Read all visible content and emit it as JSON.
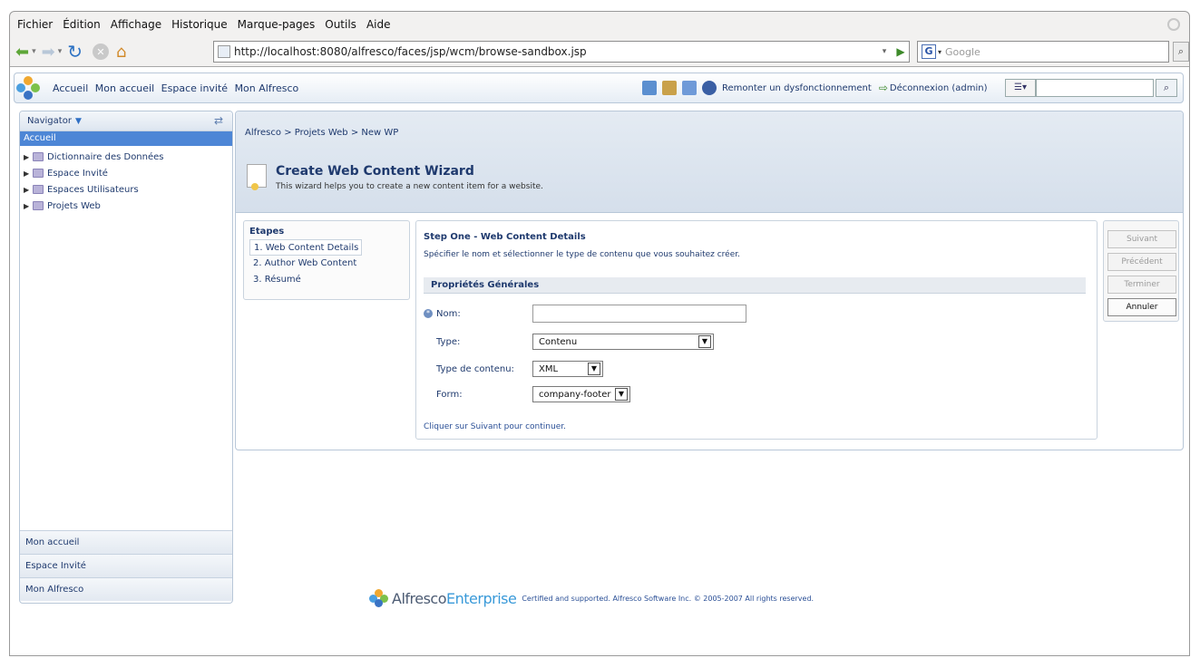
{
  "browser": {
    "menu": [
      {
        "label": "Fichier"
      },
      {
        "label": "Édition"
      },
      {
        "label": "Affichage"
      },
      {
        "label": "Historique"
      },
      {
        "label": "Marque-pages"
      },
      {
        "label": "Outils"
      },
      {
        "label": "Aide"
      }
    ],
    "url": "http://localhost:8080/alfresco/faces/jsp/wcm/browse-sandbox.jsp",
    "search_placeholder": "Google"
  },
  "topbar": {
    "links": [
      "Accueil",
      "Mon accueil",
      "Espace invité",
      "Mon Alfresco"
    ],
    "report_link": "Remonter un dysfonctionnement",
    "logout_link": "Déconnexion (admin)"
  },
  "navigator": {
    "title": "Navigator",
    "selected": "Accueil",
    "tree": [
      {
        "label": "Dictionnaire des Données"
      },
      {
        "label": "Espace Invité"
      },
      {
        "label": "Espaces Utilisateurs"
      },
      {
        "label": "Projets Web"
      }
    ],
    "bottom": [
      "Mon accueil",
      "Espace Invité",
      "Mon Alfresco"
    ]
  },
  "main": {
    "breadcrumb": "Alfresco > Projets Web > New WP",
    "title": "Create Web Content Wizard",
    "description": "This wizard helps you to create a new content item for a website.",
    "steps": {
      "title": "Etapes",
      "items": [
        "1. Web Content Details",
        "2. Author Web Content",
        "3. Résumé"
      ]
    },
    "content": {
      "title": "Step One - Web Content Details",
      "description": "Spécifier le nom et sélectionner le type de contenu que vous souhaitez créer.",
      "section": "Propriétés Générales",
      "fields": {
        "name_label": "Nom:",
        "name_value": "",
        "type_label": "Type:",
        "type_value": "Contenu",
        "content_type_label": "Type de contenu:",
        "content_type_value": "XML",
        "form_label": "Form:",
        "form_value": "company-footer"
      },
      "footer": "Cliquer sur Suivant pour continuer."
    },
    "buttons": [
      {
        "label": "Suivant",
        "enabled": false
      },
      {
        "label": "Précédent",
        "enabled": false
      },
      {
        "label": "Terminer",
        "enabled": false
      },
      {
        "label": "Annuler",
        "enabled": true
      }
    ]
  },
  "footer": {
    "brand": "Alfresco",
    "brand_suffix": "Enterprise",
    "copyright": "Certified and supported. Alfresco Software Inc. © 2005-2007 All rights reserved."
  }
}
